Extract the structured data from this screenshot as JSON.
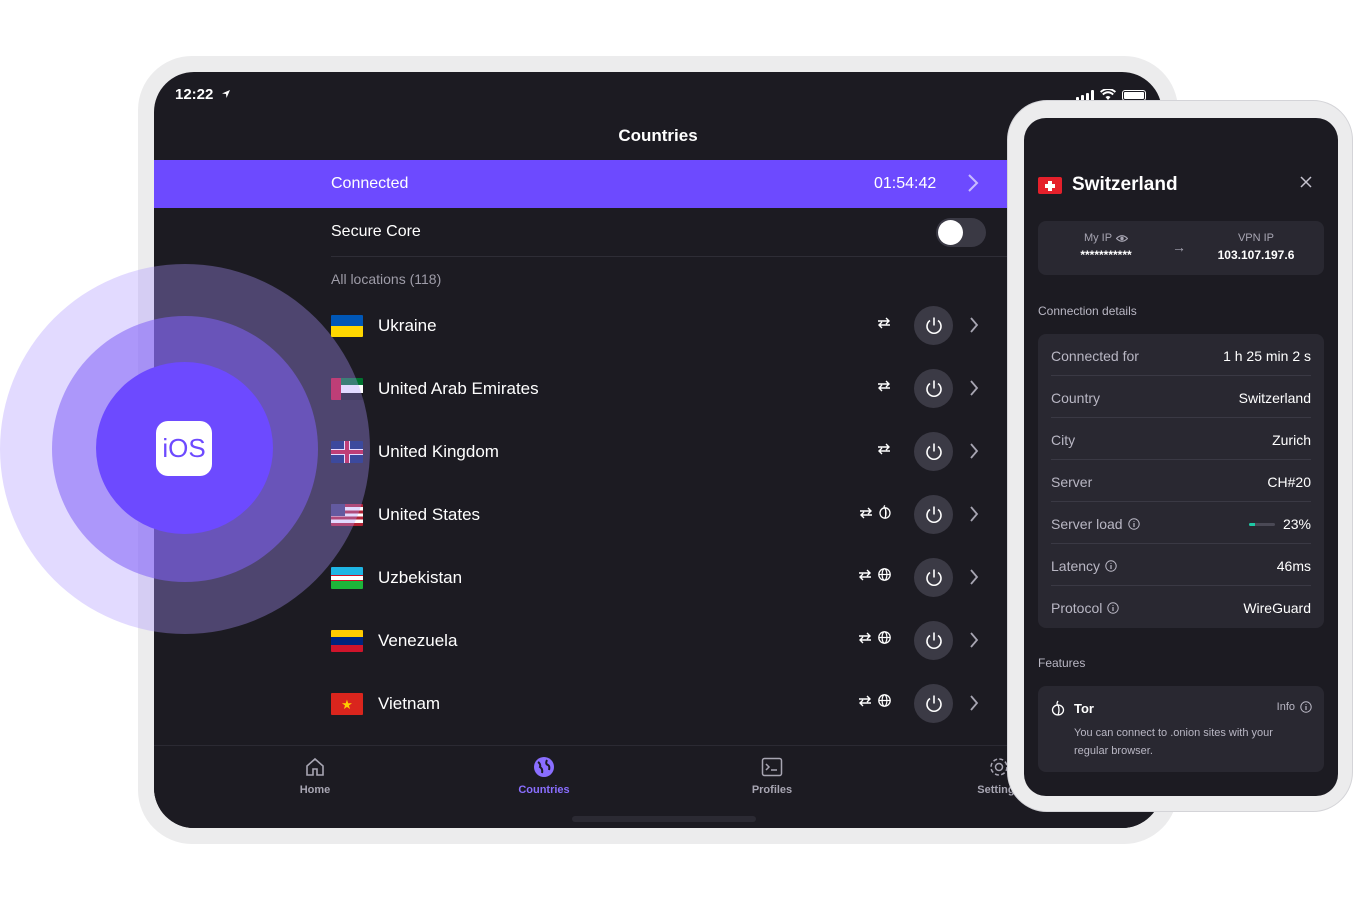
{
  "ipad": {
    "status_time": "12:22",
    "nav_title": "Countries",
    "connected": {
      "label": "Connected",
      "timer": "01:54:42"
    },
    "secure_core": {
      "label": "Secure Core",
      "enabled": false
    },
    "section_header": "All locations (118)",
    "countries": [
      {
        "name": "Ukraine",
        "flag": "ukraine",
        "features": [
          "p2p-icon"
        ]
      },
      {
        "name": "United Arab Emirates",
        "flag": "uae",
        "features": [
          "p2p-icon"
        ]
      },
      {
        "name": "United Kingdom",
        "flag": "uk",
        "features": [
          "p2p-icon"
        ]
      },
      {
        "name": "United States",
        "flag": "us",
        "features": [
          "p2p-icon",
          "tor-icon"
        ]
      },
      {
        "name": "Uzbekistan",
        "flag": "uzbekistan",
        "features": [
          "p2p-icon",
          "globe-icon"
        ]
      },
      {
        "name": "Venezuela",
        "flag": "venezuela",
        "features": [
          "p2p-icon",
          "globe-icon"
        ]
      },
      {
        "name": "Vietnam",
        "flag": "vietnam",
        "features": [
          "p2p-icon",
          "globe-icon"
        ]
      }
    ],
    "tabs": [
      {
        "label": "Home",
        "icon": "home-icon",
        "active": false
      },
      {
        "label": "Countries",
        "icon": "globe-icon",
        "active": true
      },
      {
        "label": "Profiles",
        "icon": "profiles-icon",
        "active": false
      },
      {
        "label": "Settings",
        "icon": "gear-icon",
        "active": false
      }
    ]
  },
  "badge": {
    "label": "iOS"
  },
  "phone": {
    "country": "Switzerland",
    "my_ip": {
      "label": "My IP",
      "value": "***********"
    },
    "vpn_ip": {
      "label": "VPN IP",
      "value": "103.107.197.6"
    },
    "connection_details_header": "Connection details",
    "details": [
      {
        "label": "Connected for",
        "value": "1 h 25 min 2 s",
        "info": false
      },
      {
        "label": "Country",
        "value": "Switzerland",
        "info": false
      },
      {
        "label": "City",
        "value": "Zurich",
        "info": false
      },
      {
        "label": "Server",
        "value": "CH#20",
        "info": false
      },
      {
        "label": "Server load",
        "value": "23%",
        "info": true,
        "load": 0.23
      },
      {
        "label": "Latency",
        "value": "46ms",
        "info": true
      },
      {
        "label": "Protocol",
        "value": "WireGuard",
        "info": true
      }
    ],
    "features_header": "Features",
    "feature": {
      "title": "Tor",
      "info_label": "Info",
      "description": "You can connect to .onion sites with your regular browser."
    }
  },
  "colors": {
    "accent": "#6d4aff",
    "load_bar": "#1ec9a5",
    "background": "#1c1b22"
  }
}
